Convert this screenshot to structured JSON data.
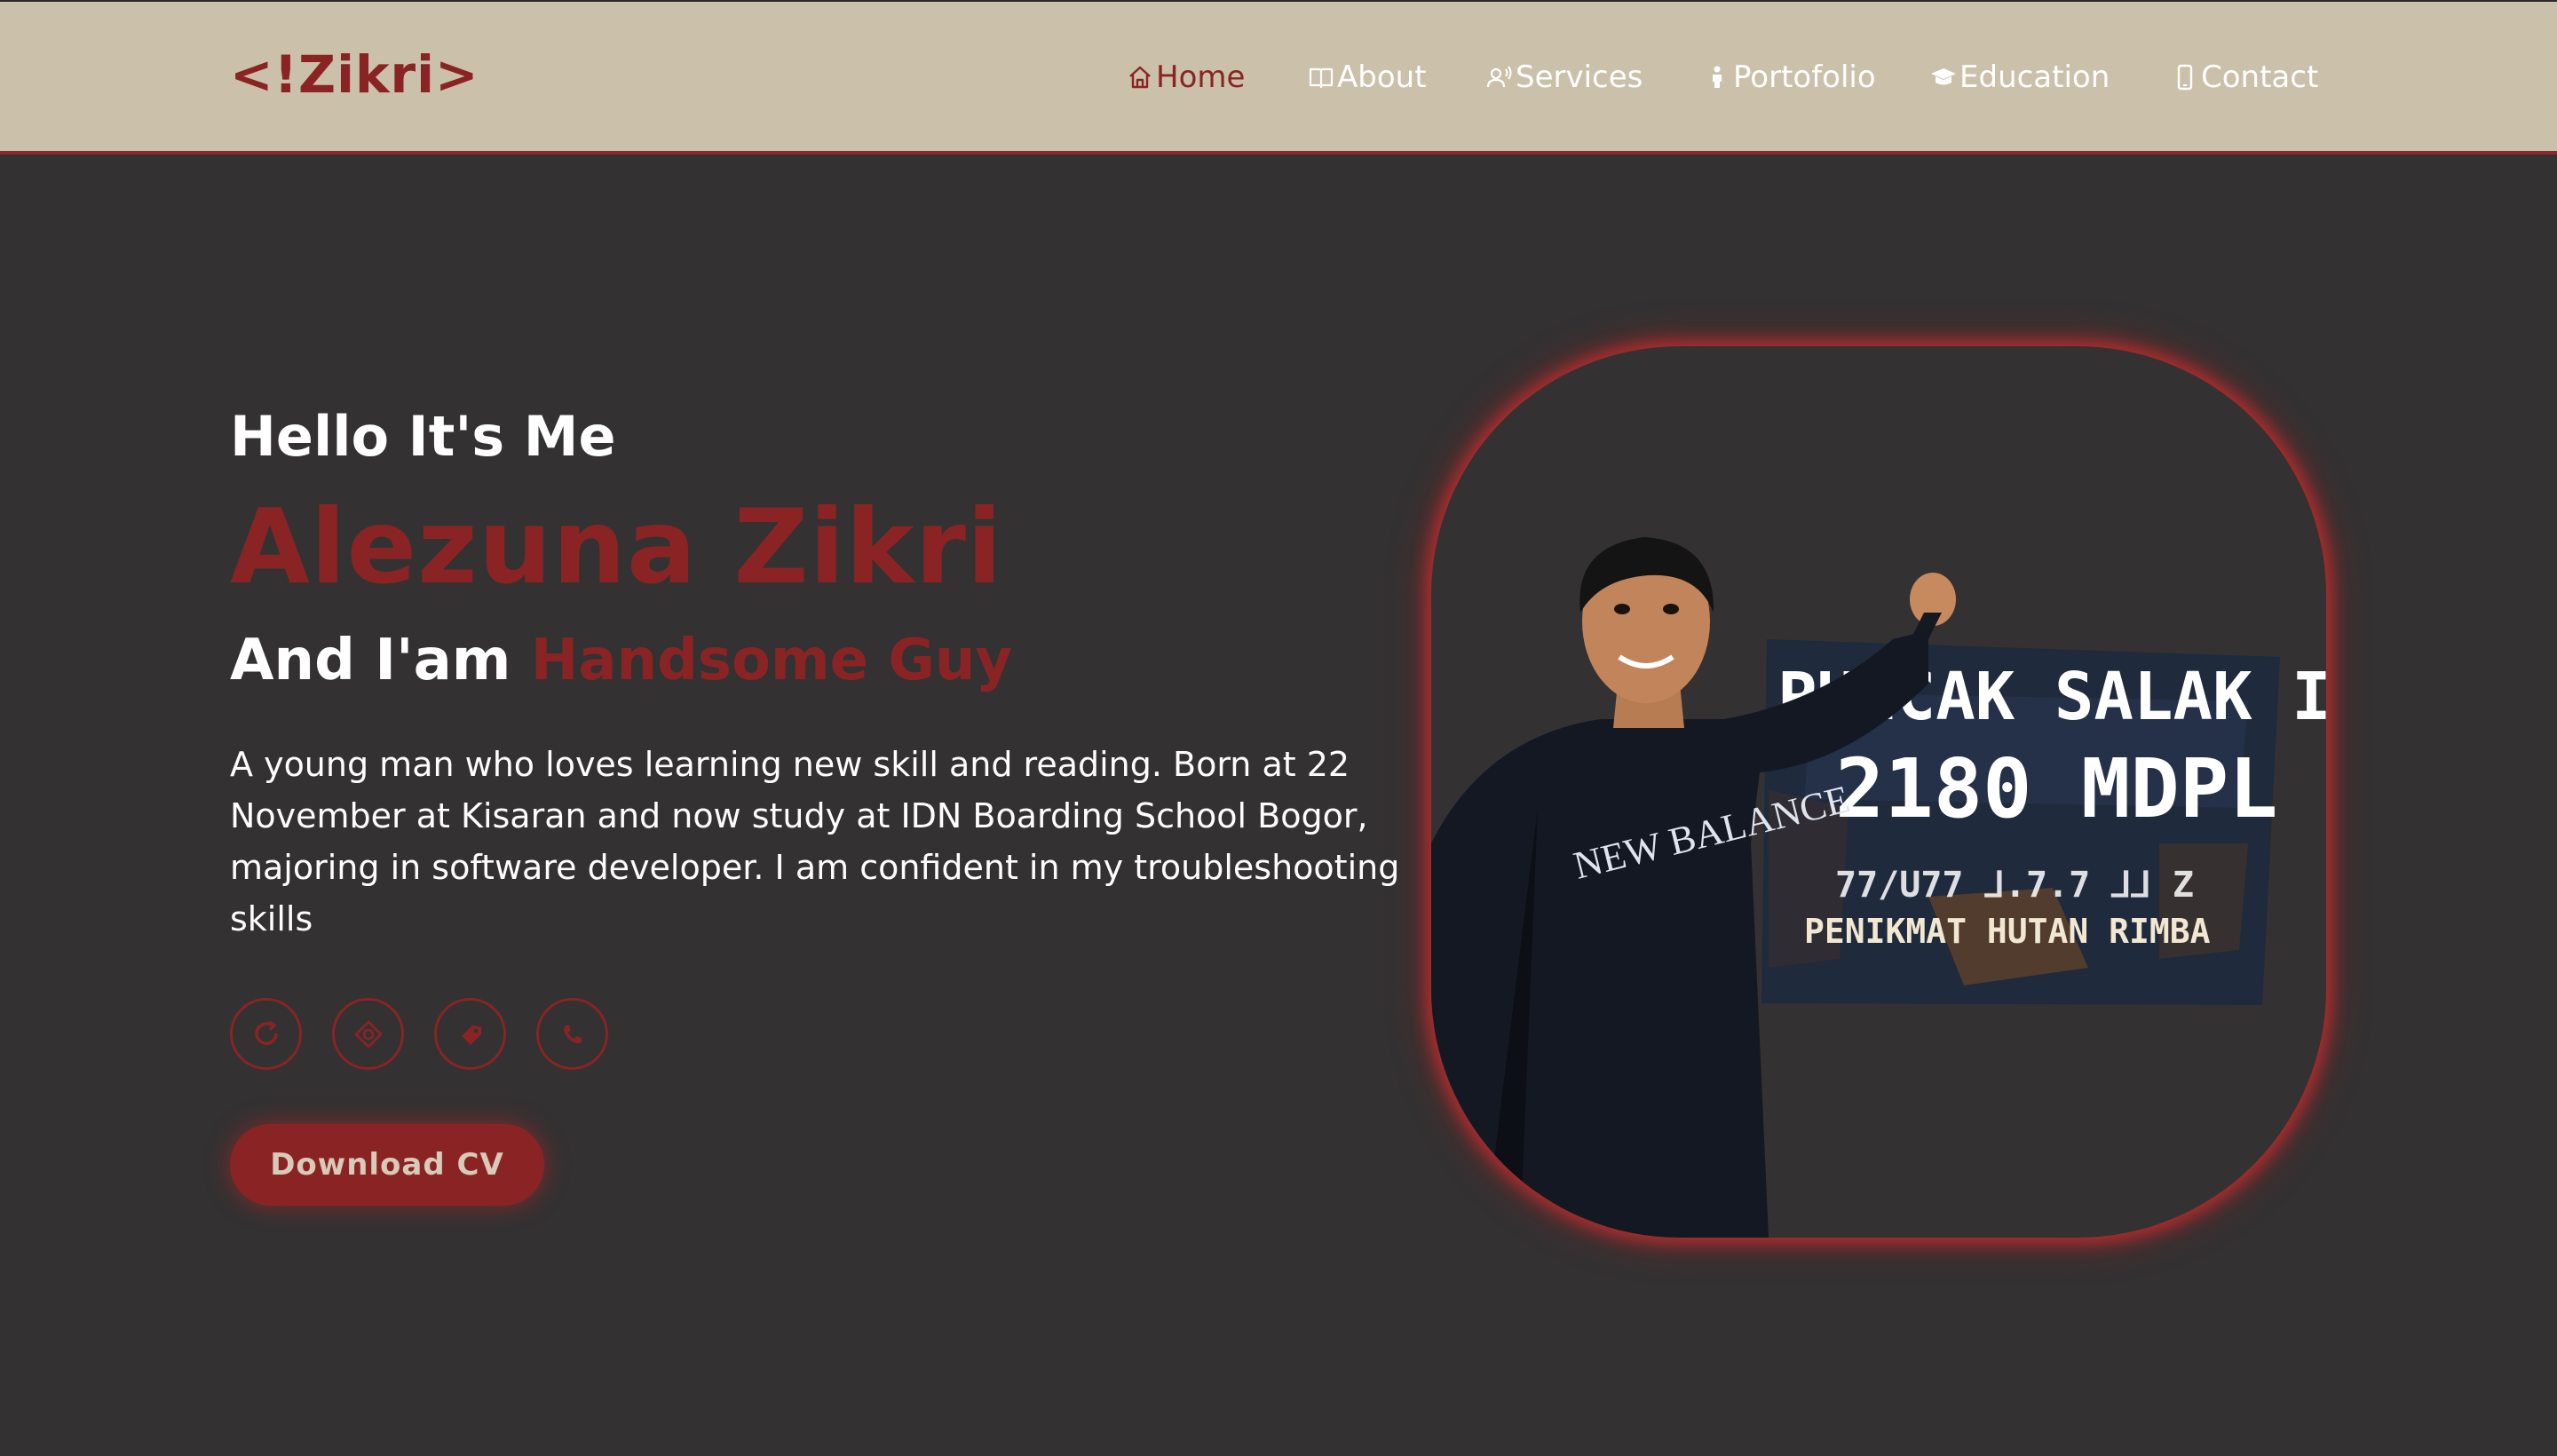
{
  "header": {
    "logo": "<!Zikri>",
    "nav": [
      {
        "label": "Home",
        "icon": "home-icon",
        "active": true
      },
      {
        "label": "About",
        "icon": "book-icon",
        "active": false
      },
      {
        "label": "Services",
        "icon": "user-voice-icon",
        "active": false
      },
      {
        "label": "Portofolio",
        "icon": "person-icon",
        "active": false
      },
      {
        "label": "Education",
        "icon": "graduation-cap-icon",
        "active": false
      },
      {
        "label": "Contact",
        "icon": "phone-icon",
        "active": false
      }
    ]
  },
  "hero": {
    "greeting": "Hello It's Me",
    "name": "Alezuna Zikri",
    "role_prefix": "And I'am",
    "role_highlight": "Handsome Guy",
    "description": "A young man who loves learning new skill and reading. Born at 22 November at Kisaran and now study at IDN Boarding School Bogor, majoring in software developer. I am confident in my troubleshooting skills",
    "socials": [
      {
        "icon": "refresh-icon"
      },
      {
        "icon": "diamond-icon"
      },
      {
        "icon": "tag-icon"
      },
      {
        "icon": "phone-handset-icon"
      }
    ],
    "cv_button": "Download CV"
  },
  "photo": {
    "sign_line1": "PUNCAK SALAK II",
    "sign_line2": "2180 MDPL",
    "sign_line4": "PENIKMAT HUTAN RIMBA",
    "shirt_text": "NEW BALANCE"
  },
  "colors": {
    "accent": "#8a2424",
    "header_bg": "#cbc0a9",
    "page_bg": "#333132",
    "text": "#ffffff"
  }
}
